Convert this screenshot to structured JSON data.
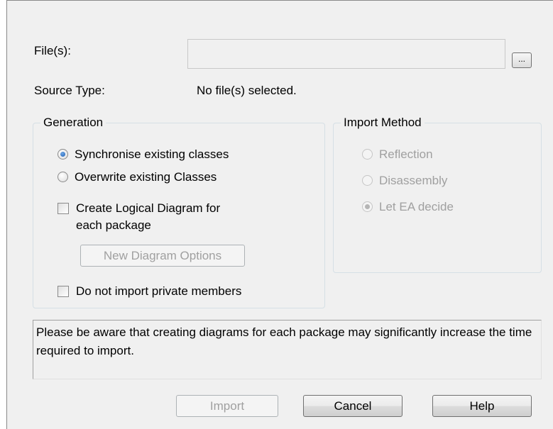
{
  "files": {
    "label": "File(s):",
    "value": "",
    "browse_label": "..."
  },
  "source_type": {
    "label": "Source Type:",
    "value": "No file(s) selected."
  },
  "generation": {
    "title": "Generation",
    "synchronise_label": "Synchronise existing classes",
    "overwrite_label": "Overwrite existing Classes",
    "create_logical_diagram_label_line1": "Create Logical Diagram for",
    "create_logical_diagram_label_line2": "each package",
    "new_diagram_options_label": "New Diagram Options",
    "do_not_import_private_label": "Do not import private members",
    "selected": "synchronise"
  },
  "import_method": {
    "title": "Import Method",
    "reflection_label": "Reflection",
    "disassembly_label": "Disassembly",
    "let_ea_decide_label": "Let EA decide",
    "selected": "let_ea_decide"
  },
  "info_message": "Please be aware that creating diagrams for each package may significantly increase the time required to import.",
  "buttons": {
    "import_label": "Import",
    "cancel_label": "Cancel",
    "help_label": "Help"
  },
  "colors": {
    "dialog_bg": "#f0f0f0",
    "disabled_text": "#a0a0a0",
    "radio_selected": "#1f5fb3"
  }
}
